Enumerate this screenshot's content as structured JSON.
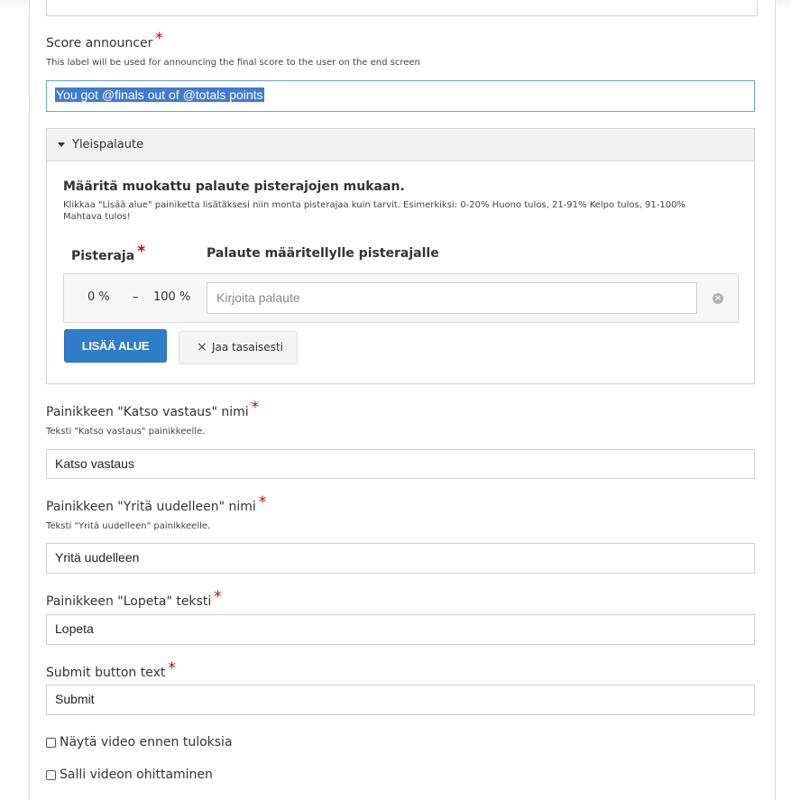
{
  "score_announcer": {
    "label": "Score announcer",
    "required_mark": "*",
    "description": "This label will be used for announcing the final score to the user on the end screen",
    "value": "You got @finals out of @totals points"
  },
  "overall_feedback": {
    "group_title": "Yleispalaute",
    "heading": "Määritä muokattu palaute pisterajojen mukaan.",
    "help_line1": "Klikkaa \"Lisää alue\" painiketta lisätäksesi niin monta pisterajaa kuin tarvit. Esimerkiksi: 0-20% Huono tulos, 21-91% Kelpo tulos, 91-100%",
    "help_line2": "Mahtava tulos!",
    "col_range": "Pisteraja",
    "col_feedback": "Palaute määritellylle pisterajalle",
    "range_from": "0 %",
    "range_dash": "–",
    "range_to": "100 %",
    "feedback_placeholder": "Kirjoita palaute",
    "add_range_button": "LISÄÄ ALUE",
    "distribute_button": "Jaa tasaisesti"
  },
  "show_solution": {
    "label": "Painikkeen \"Katso vastaus\" nimi",
    "description": "Teksti \"Katso vastaus\" painikkeelle.",
    "value": "Katso vastaus"
  },
  "retry": {
    "label": "Painikkeen \"Yritä uudelleen\" nimi",
    "description": "Teksti \"Yritä uudelleen\" painikkeelle.",
    "value": "Yritä uudelleen"
  },
  "finish": {
    "label": "Painikkeen \"Lopeta\" teksti",
    "value": "Lopeta"
  },
  "submit": {
    "label": "Submit button text",
    "value": "Submit"
  },
  "checkboxes": {
    "show_video": "Näytä video ennen tuloksia",
    "skip_video": "Salli videon ohittaminen"
  }
}
